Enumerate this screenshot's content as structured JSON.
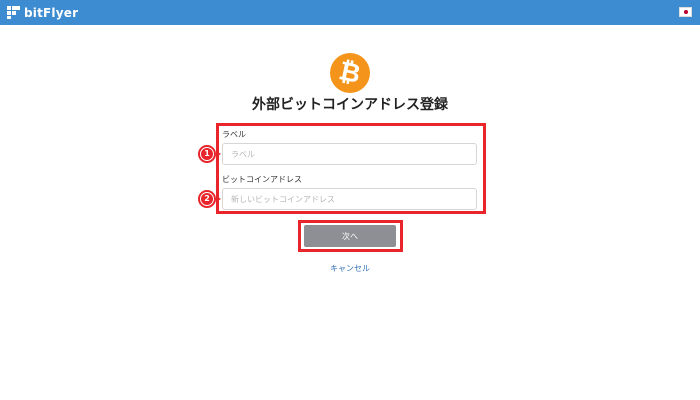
{
  "header": {
    "brand": "bitFlyer",
    "brand_color": "#3d8bd0",
    "language_icon": "japan-flag-icon"
  },
  "page": {
    "title": "外部ビットコインアドレス登録",
    "coin_icon": "bitcoin-icon",
    "coin_symbol": "₿",
    "coin_color": "#f4941a"
  },
  "form": {
    "label_field": {
      "label": "ラベル",
      "placeholder": "ラベル",
      "value": "",
      "step": "1"
    },
    "address_field": {
      "label": "ビットコインアドレス",
      "placeholder": "新しいビットコインアドレス",
      "value": "",
      "step": "2"
    }
  },
  "actions": {
    "next_label": "次へ",
    "cancel_label": "キャンセル"
  },
  "annotations": {
    "highlight_color": "#e8252b"
  }
}
